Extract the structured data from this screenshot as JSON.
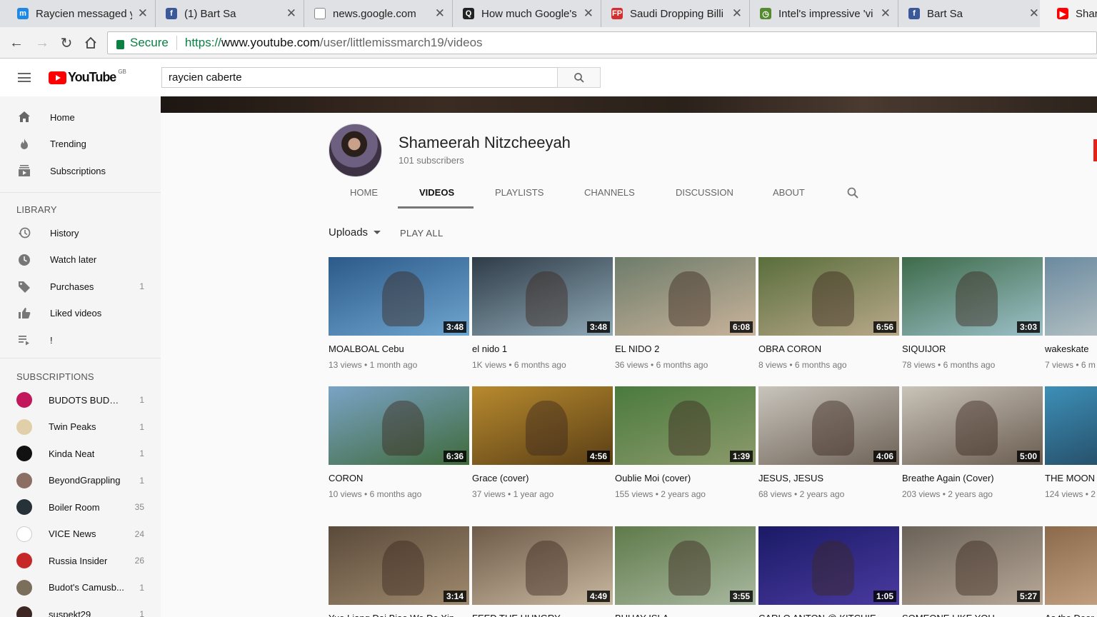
{
  "browser": {
    "tabs": [
      {
        "title": "Raycien messaged y",
        "favicon": "messenger-icon",
        "color": "#1e88e5"
      },
      {
        "title": "(1) Bart Sa",
        "favicon": "facebook-icon",
        "color": "#3b5998"
      },
      {
        "title": "news.google.com",
        "favicon": "page-icon",
        "color": "#9e9e9e"
      },
      {
        "title": "How much Google's",
        "favicon": "quora-icon",
        "color": "#222222"
      },
      {
        "title": "Saudi Dropping Billi",
        "favicon": "fp-icon",
        "color": "#d32f2f"
      },
      {
        "title": "Intel's impressive 'vi",
        "favicon": "clock-icon",
        "color": "#558b2f"
      },
      {
        "title": "Bart Sa",
        "favicon": "facebook-icon",
        "color": "#3b5998"
      },
      {
        "title": "Shar",
        "favicon": "youtube-icon",
        "color": "#ff0000"
      }
    ],
    "close_glyph": "✕",
    "secure_label": "Secure",
    "url_scheme": "https://",
    "url_host": "www.youtube.com",
    "url_path": "/user/littlemissmarch19/videos"
  },
  "masthead": {
    "logo_text": "YouTube",
    "region": "GB",
    "search_value": "raycien caberte"
  },
  "sidebar": {
    "main": [
      {
        "label": "Home",
        "icon": "home-icon"
      },
      {
        "label": "Trending",
        "icon": "flame-icon"
      },
      {
        "label": "Subscriptions",
        "icon": "subscriptions-icon"
      }
    ],
    "library_heading": "LIBRARY",
    "library": [
      {
        "label": "History",
        "icon": "history-icon",
        "count": ""
      },
      {
        "label": "Watch later",
        "icon": "clock-icon",
        "count": ""
      },
      {
        "label": "Purchases",
        "icon": "tag-icon",
        "count": "1"
      },
      {
        "label": "Liked videos",
        "icon": "thumbs-up-icon",
        "count": ""
      },
      {
        "label": "!",
        "icon": "playlist-icon",
        "count": ""
      }
    ],
    "subscriptions_heading": "SUBSCRIPTIONS",
    "subscriptions": [
      {
        "label": "BUDOTS BUDOTS",
        "count": "1",
        "color": "#c2185b"
      },
      {
        "label": "Twin Peaks",
        "count": "1",
        "color": "#e0cfa8"
      },
      {
        "label": "Kinda Neat",
        "count": "1",
        "color": "#111111"
      },
      {
        "label": "BeyondGrappling",
        "count": "1",
        "color": "#8d6e63"
      },
      {
        "label": "Boiler Room",
        "count": "35",
        "color": "#263238"
      },
      {
        "label": "VICE News",
        "count": "24",
        "color": "#ffffff"
      },
      {
        "label": "Russia Insider",
        "count": "26",
        "color": "#c62828"
      },
      {
        "label": "Budot's Camusb...",
        "count": "1",
        "color": "#7b6f5b"
      },
      {
        "label": "suspekt29",
        "count": "1",
        "color": "#3e2723"
      }
    ]
  },
  "channel": {
    "name": "Shameerah Nitzcheeyah",
    "subscribers": "101 subscribers",
    "tabs": [
      "HOME",
      "VIDEOS",
      "PLAYLISTS",
      "CHANNELS",
      "DISCUSSION",
      "ABOUT"
    ],
    "active_tab": "VIDEOS",
    "uploads_label": "Uploads",
    "play_all_label": "PLAY ALL"
  },
  "videos": [
    {
      "title": "MOALBOAL Cebu",
      "views": "13 views",
      "age": "1 month ago",
      "duration": "3:48",
      "bg": [
        "#2c5a8a",
        "#6fa6cf"
      ]
    },
    {
      "title": "el nido 1",
      "views": "1K views",
      "age": "6 months ago",
      "duration": "3:48",
      "bg": [
        "#2f3c48",
        "#8fa9b6"
      ]
    },
    {
      "title": "EL NIDO 2",
      "views": "36 views",
      "age": "6 months ago",
      "duration": "6:08",
      "bg": [
        "#6d7c6a",
        "#c9b39b"
      ]
    },
    {
      "title": "OBRA CORON",
      "views": "8 views",
      "age": "6 months ago",
      "duration": "6:56",
      "bg": [
        "#5a6e3c",
        "#b8a88a"
      ]
    },
    {
      "title": "SIQUIJOR",
      "views": "78 views",
      "age": "6 months ago",
      "duration": "3:03",
      "bg": [
        "#3e6b4a",
        "#9cc0c8"
      ]
    },
    {
      "title": "wakeskate",
      "views": "7 views",
      "age": "6 m",
      "duration": "",
      "bg": [
        "#6b8aa0",
        "#c7cfcc"
      ]
    },
    {
      "title": "CORON",
      "views": "10 views",
      "age": "6 months ago",
      "duration": "6:36",
      "bg": [
        "#7aa3c7",
        "#3f6a3a"
      ]
    },
    {
      "title": "Grace (cover)",
      "views": "37 views",
      "age": "1 year ago",
      "duration": "4:56",
      "bg": [
        "#b88a2e",
        "#5a3f16"
      ]
    },
    {
      "title": "Oublie Moi (cover)",
      "views": "155 views",
      "age": "2 years ago",
      "duration": "1:39",
      "bg": [
        "#4a7a3e",
        "#8c9a6b"
      ]
    },
    {
      "title": "JESUS, JESUS",
      "views": "68 views",
      "age": "2 years ago",
      "duration": "4:06",
      "bg": [
        "#c8c4bc",
        "#6e6256"
      ]
    },
    {
      "title": "Breathe Again (Cover)",
      "views": "203 views",
      "age": "2 years ago",
      "duration": "5:00",
      "bg": [
        "#c9c3b8",
        "#6a5c50"
      ]
    },
    {
      "title": "THE MOON I HEART (Cove",
      "views": "124 views",
      "age": "2",
      "duration": "",
      "bg": [
        "#3d8fb8",
        "#1f3d52"
      ]
    },
    {
      "title": "Yue Liang Dai Biao Wo De Xin",
      "views": "",
      "age": "",
      "duration": "3:14",
      "bg": [
        "#5a4a3a",
        "#a08a6e"
      ]
    },
    {
      "title": "FEED THE HUNGRY",
      "views": "",
      "age": "",
      "duration": "4:49",
      "bg": [
        "#6e5a48",
        "#c9b8a0"
      ]
    },
    {
      "title": "BUHAY ISLA",
      "views": "",
      "age": "",
      "duration": "3:55",
      "bg": [
        "#5f7a4a",
        "#a9b8a0"
      ]
    },
    {
      "title": "CARLO ANTON @ KITCHIE",
      "views": "",
      "age": "",
      "duration": "1:05",
      "bg": [
        "#1a1a66",
        "#4a3aa0"
      ]
    },
    {
      "title": "SOMEONE LIKE YOU",
      "views": "",
      "age": "",
      "duration": "5:27",
      "bg": [
        "#6a6258",
        "#b8a898"
      ]
    },
    {
      "title": "As the Deer",
      "views": "",
      "age": "",
      "duration": "",
      "bg": [
        "#8a6a4a",
        "#d0b090"
      ]
    }
  ]
}
